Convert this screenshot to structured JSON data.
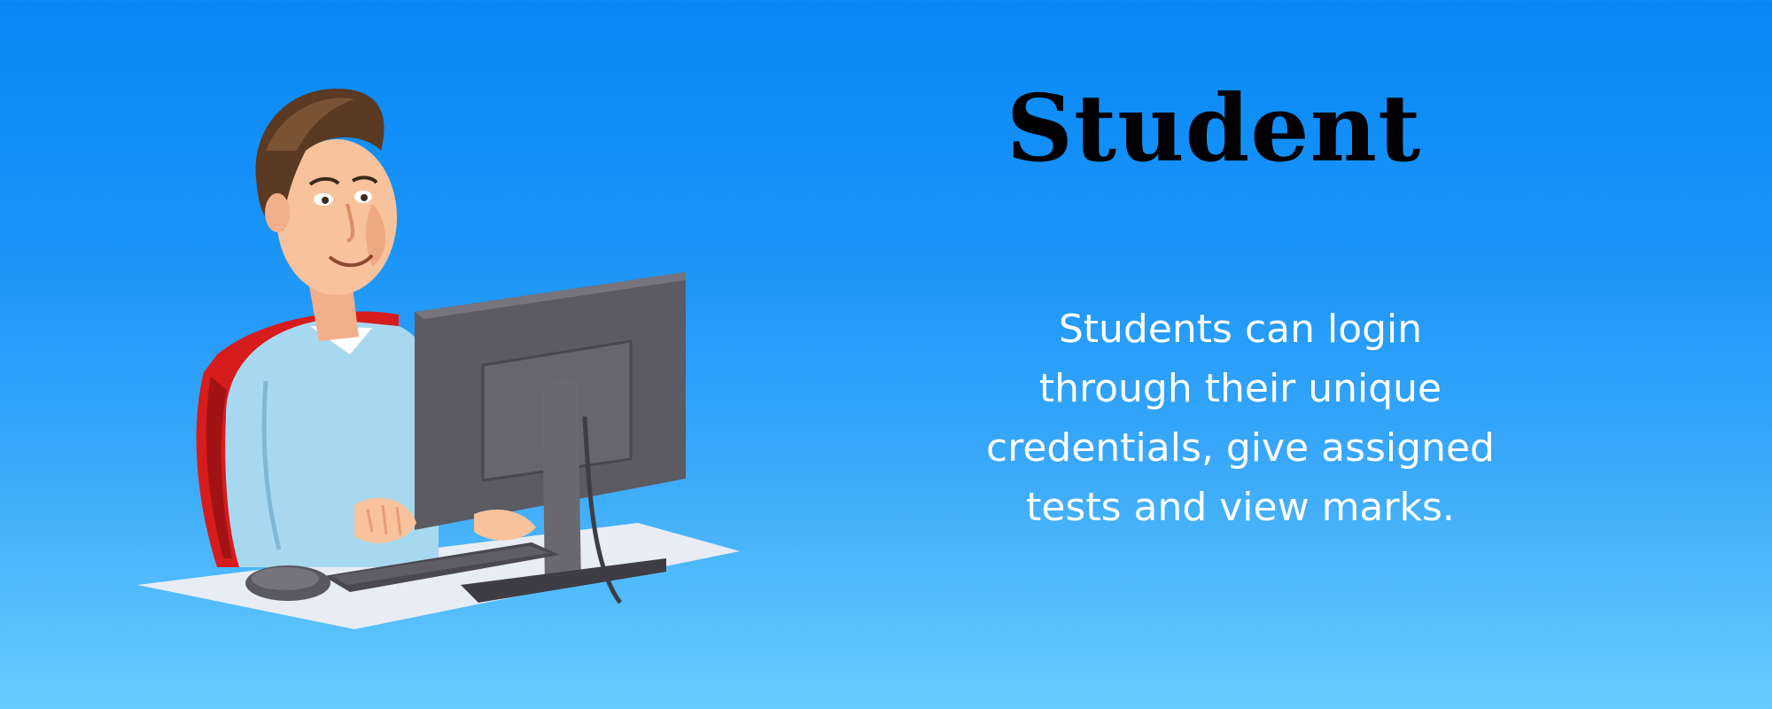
{
  "heading": {
    "title": "Student"
  },
  "description": {
    "lines": [
      "Students can login",
      "through their unique",
      "credentials, give assigned",
      "tests and view marks."
    ]
  },
  "illustration": {
    "icon": "student-at-computer-illustration"
  },
  "colors": {
    "background_top": "#0888f8",
    "background_bottom": "#66cdfd",
    "title": "#000000",
    "description": "#ffffff",
    "shirt": "#a8d8f0",
    "chair": "#e02020",
    "monitor": "#5c5a62"
  }
}
